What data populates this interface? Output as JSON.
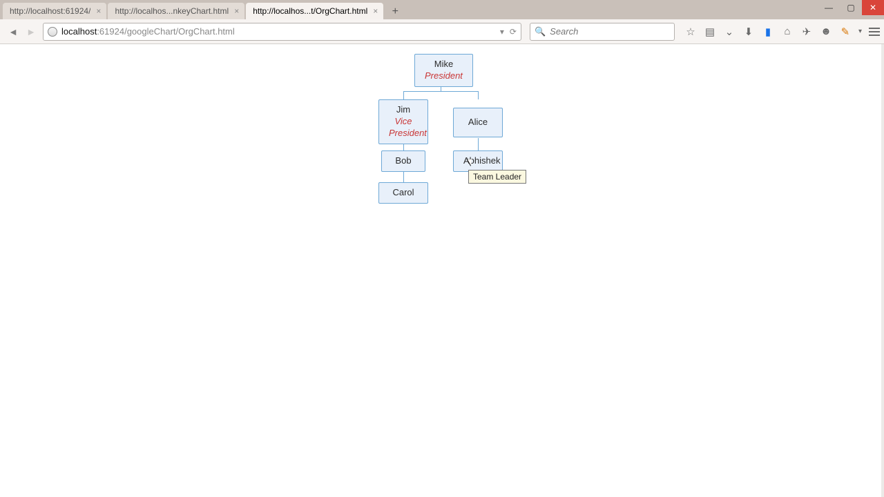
{
  "window": {
    "tabs": [
      {
        "title": "http://localhost:61924/"
      },
      {
        "title": "http://localhos...nkeyChart.html"
      },
      {
        "title": "http://localhos...t/OrgChart.html"
      }
    ],
    "active_tab": 2
  },
  "urlbar": {
    "host": "localhost",
    "port": ":61924",
    "path": "/googleChart/OrgChart.html"
  },
  "searchbar": {
    "placeholder": "Search"
  },
  "orgchart": {
    "mike": {
      "name": "Mike",
      "title": "President"
    },
    "jim": {
      "name": "Jim",
      "title": "Vice President"
    },
    "alice": {
      "name": "Alice"
    },
    "bob": {
      "name": "Bob"
    },
    "abhishek": {
      "name": "Abhishek",
      "tooltip": "Team Leader"
    },
    "carol": {
      "name": "Carol"
    }
  },
  "chart_data": {
    "type": "orgchart",
    "nodes": [
      {
        "id": "Mike",
        "parent": null,
        "title": "President"
      },
      {
        "id": "Jim",
        "parent": "Mike",
        "title": "Vice President"
      },
      {
        "id": "Alice",
        "parent": "Mike"
      },
      {
        "id": "Bob",
        "parent": "Jim"
      },
      {
        "id": "Abhishek",
        "parent": "Alice",
        "tooltip": "Team Leader"
      },
      {
        "id": "Carol",
        "parent": "Bob"
      }
    ]
  }
}
